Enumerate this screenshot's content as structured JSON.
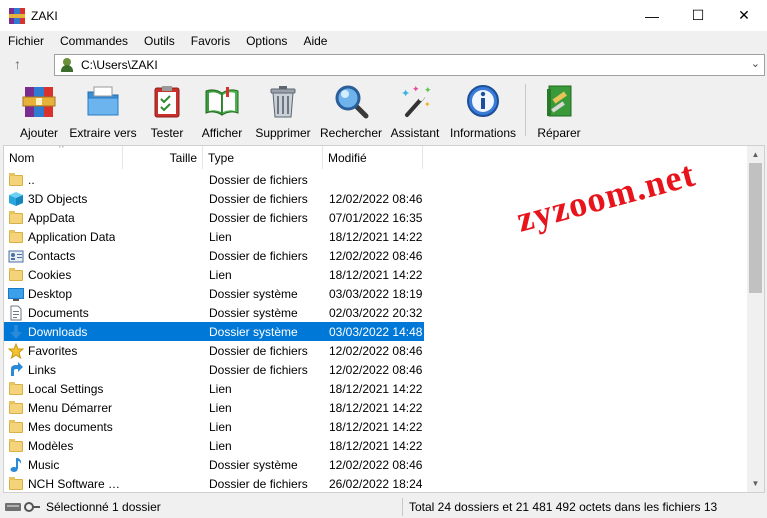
{
  "window": {
    "title": "ZAKI",
    "minimize_glyph": "—",
    "maximize_glyph": "☐",
    "close_glyph": "✕"
  },
  "menu": [
    "Fichier",
    "Commandes",
    "Outils",
    "Favoris",
    "Options",
    "Aide"
  ],
  "address": {
    "path": "C:\\Users\\ZAKI",
    "up_glyph": "↑",
    "chevron_glyph": "⌄"
  },
  "toolbar": [
    {
      "label": "Ajouter",
      "icon": "archive-books-icon"
    },
    {
      "label": "Extraire vers",
      "icon": "extract-folder-icon"
    },
    {
      "label": "Tester",
      "icon": "clipboard-check-icon"
    },
    {
      "label": "Afficher",
      "icon": "open-book-icon"
    },
    {
      "label": "Supprimer",
      "icon": "trash-can-icon"
    },
    {
      "label": "Rechercher",
      "icon": "magnifier-icon"
    },
    {
      "label": "Assistant",
      "icon": "magic-wand-icon"
    },
    {
      "label": "Informations",
      "icon": "info-icon"
    },
    {
      "label": "Réparer",
      "icon": "first-aid-book-icon"
    }
  ],
  "columns": {
    "name": "Nom",
    "size": "Taille",
    "type": "Type",
    "modified": "Modifié"
  },
  "files": [
    {
      "name": "..",
      "type": "Dossier de fichiers",
      "modified": "",
      "icon": "folder-icon"
    },
    {
      "name": "3D Objects",
      "type": "Dossier de fichiers",
      "modified": "12/02/2022 08:46",
      "icon": "3d-objects-icon"
    },
    {
      "name": "AppData",
      "type": "Dossier de fichiers",
      "modified": "07/01/2022 16:35",
      "icon": "folder-icon"
    },
    {
      "name": "Application Data",
      "type": "Lien",
      "modified": "18/12/2021 14:22",
      "icon": "folder-icon"
    },
    {
      "name": "Contacts",
      "type": "Dossier de fichiers",
      "modified": "12/02/2022 08:46",
      "icon": "contacts-icon"
    },
    {
      "name": "Cookies",
      "type": "Lien",
      "modified": "18/12/2021 14:22",
      "icon": "folder-icon"
    },
    {
      "name": "Desktop",
      "type": "Dossier système",
      "modified": "03/03/2022 18:19",
      "icon": "desktop-icon"
    },
    {
      "name": "Documents",
      "type": "Dossier système",
      "modified": "02/03/2022 20:32",
      "icon": "documents-icon"
    },
    {
      "name": "Downloads",
      "type": "Dossier système",
      "modified": "03/03/2022 14:48",
      "icon": "download-arrow-icon",
      "selected": true
    },
    {
      "name": "Favorites",
      "type": "Dossier de fichiers",
      "modified": "12/02/2022 08:46",
      "icon": "star-icon"
    },
    {
      "name": "Links",
      "type": "Dossier de fichiers",
      "modified": "12/02/2022 08:46",
      "icon": "link-arrow-icon"
    },
    {
      "name": "Local Settings",
      "type": "Lien",
      "modified": "18/12/2021 14:22",
      "icon": "folder-icon"
    },
    {
      "name": "Menu Démarrer",
      "type": "Lien",
      "modified": "18/12/2021 14:22",
      "icon": "folder-icon"
    },
    {
      "name": "Mes documents",
      "type": "Lien",
      "modified": "18/12/2021 14:22",
      "icon": "folder-icon"
    },
    {
      "name": "Modèles",
      "type": "Lien",
      "modified": "18/12/2021 14:22",
      "icon": "folder-icon"
    },
    {
      "name": "Music",
      "type": "Dossier système",
      "modified": "12/02/2022 08:46",
      "icon": "music-note-icon"
    },
    {
      "name": "NCH Software S...",
      "type": "Dossier de fichiers",
      "modified": "26/02/2022 18:24",
      "icon": "folder-icon"
    }
  ],
  "watermark": "zyzoom.net",
  "status": {
    "left": "Sélectionné 1 dossier",
    "right": "Total 24 dossiers et 21 481 492 octets dans les fichiers 13"
  },
  "colors": {
    "selection": "#0078d7",
    "watermark": "#e8141c",
    "folder": "#f4d37a"
  }
}
